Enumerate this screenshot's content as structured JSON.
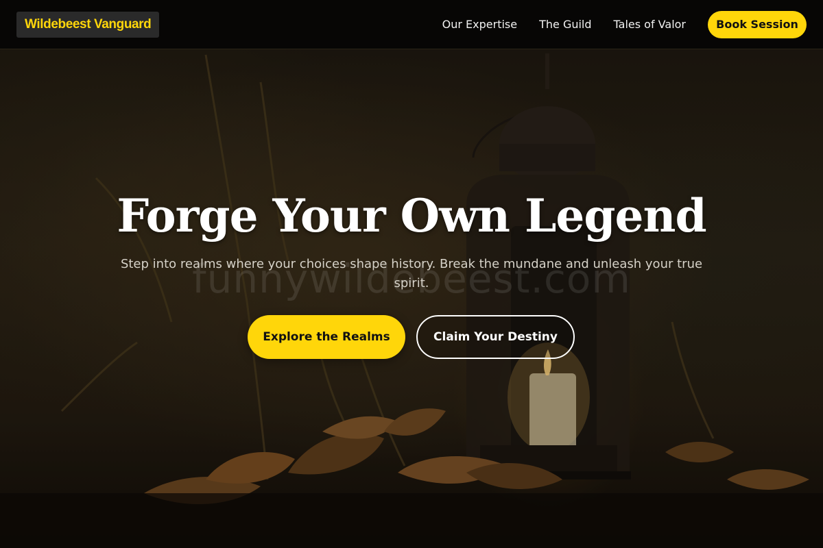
{
  "nav": {
    "brand": "Wildebeest Vanguard",
    "links": [
      {
        "label": "Our Expertise"
      },
      {
        "label": "The Guild"
      },
      {
        "label": "Tales of Valor"
      }
    ],
    "cta_label": "Book Session"
  },
  "hero": {
    "title": "Forge Your Own Legend",
    "subtitle": "Step into realms where your choices shape history. Break the mundane and unleash your true spirit.",
    "watermark": "funnywildebeest.com",
    "primary_cta": "Explore the Realms",
    "secondary_cta": "Claim Your Destiny"
  },
  "colors": {
    "accent": "#ffd60a",
    "nav_background": "#070605",
    "text_light": "#ffffff"
  },
  "icons": [
    "lantern-illustration",
    "autumn-leaves-illustration"
  ]
}
